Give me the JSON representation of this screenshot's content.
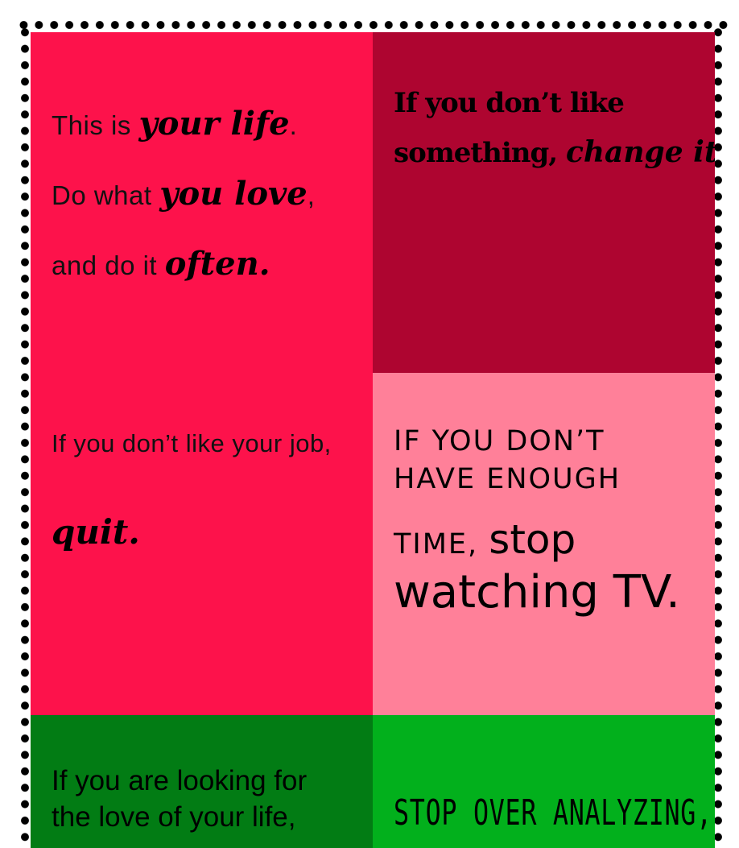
{
  "colors": {
    "panel1": "#fd124b",
    "panel2": "#ae0530",
    "panel3": "#ff8099",
    "panel4": "#027c14",
    "panel5": "#02b01c",
    "border_dots": "#000000"
  },
  "panel1": {
    "line1_a": "This is ",
    "line1_b": "your life",
    "line1_c": ".",
    "line2_a": "Do what ",
    "line2_b": "you love",
    "line2_c": ",",
    "line3_a": "and do it ",
    "line3_b": "often.",
    "line4": "If you don’t like your job,",
    "line5": "quit."
  },
  "panel2": {
    "line1": "If you don’t like",
    "line2_a": "something, ",
    "line2_b": "change it."
  },
  "panel3": {
    "line1": "IF YOU DON’T",
    "line2": "HAVE ENOUGH",
    "line3_a": "TIME, ",
    "line3_b": "stop",
    "line4": "watching TV."
  },
  "panel4": {
    "line1": "If you are looking for",
    "line2": "the love of your life,"
  },
  "panel5": {
    "line1": "STOP OVER ANALYZING,"
  }
}
